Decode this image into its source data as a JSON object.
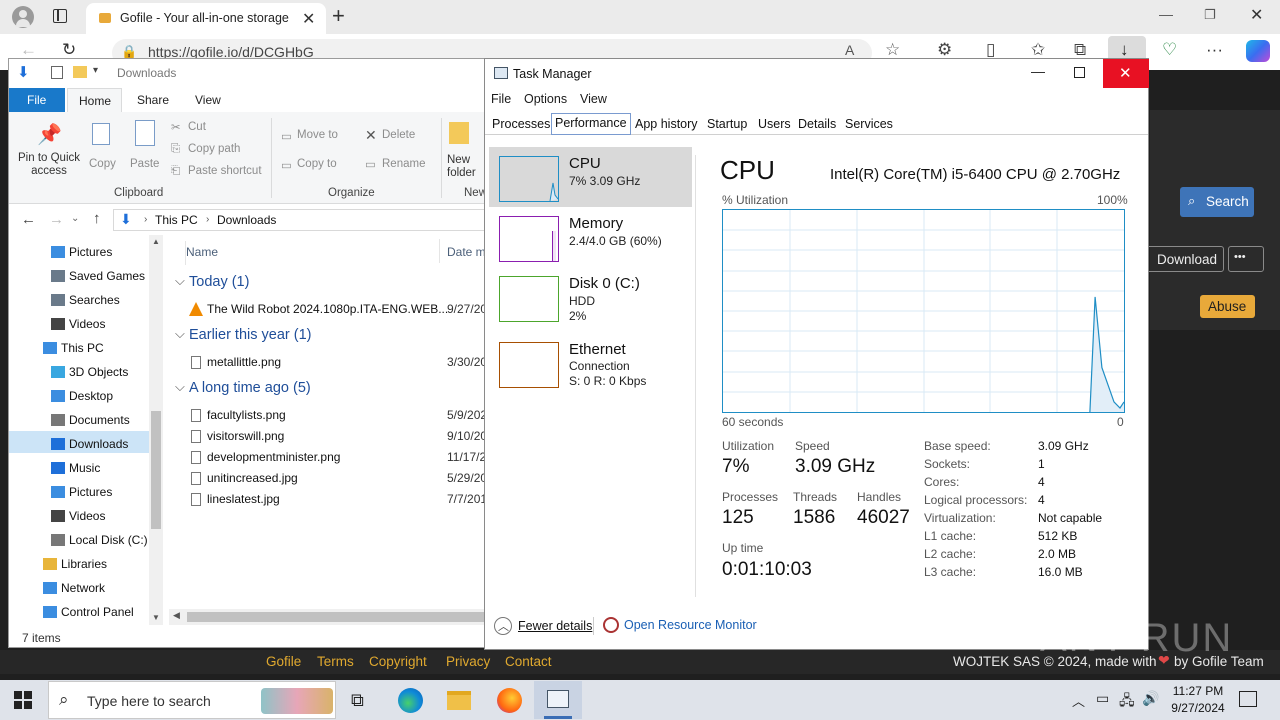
{
  "browser": {
    "tab_title": "Gofile - Your all-in-one storage s",
    "url": "https://gofile.io/d/DCGHbG"
  },
  "gofile": {
    "search_label": "Search",
    "download_label": "Download",
    "more_label": "•••",
    "abuse_label": "Abuse",
    "footer_links": [
      "Gofile",
      "Terms",
      "Copyright",
      "Privacy",
      "Contact"
    ],
    "footer_credit_pre": "WOJTEK SAS © 2024, made with",
    "footer_credit_post": "by Gofile Team",
    "accent_color": "#e0a92f"
  },
  "explorer": {
    "title": "Downloads",
    "ribbon_tabs": [
      "File",
      "Home",
      "Share",
      "View"
    ],
    "clipboard": {
      "pin": "Pin to Quick access",
      "copy": "Copy",
      "paste": "Paste",
      "cut": "Cut",
      "copy_path": "Copy path",
      "paste_shortcut": "Paste shortcut",
      "group": "Clipboard"
    },
    "organize": {
      "move_to": "Move to",
      "copy_to": "Copy to",
      "delete": "Delete",
      "rename": "Rename",
      "group": "Organize"
    },
    "new": {
      "new_folder": "New folder",
      "group": "New"
    },
    "breadcrumb": [
      "This PC",
      "Downloads"
    ],
    "nav": [
      {
        "label": "Pictures",
        "icon": "pictures-icon"
      },
      {
        "label": "Saved Games",
        "icon": "saved-games-icon"
      },
      {
        "label": "Searches",
        "icon": "searches-icon"
      },
      {
        "label": "Videos",
        "icon": "videos-icon"
      },
      {
        "label": "This PC",
        "icon": "this-pc-icon"
      },
      {
        "label": "3D Objects",
        "icon": "3d-objects-icon"
      },
      {
        "label": "Desktop",
        "icon": "desktop-icon"
      },
      {
        "label": "Documents",
        "icon": "documents-icon"
      },
      {
        "label": "Downloads",
        "icon": "downloads-icon"
      },
      {
        "label": "Music",
        "icon": "music-icon"
      },
      {
        "label": "Pictures",
        "icon": "pictures-icon"
      },
      {
        "label": "Videos",
        "icon": "videos-icon"
      },
      {
        "label": "Local Disk (C:)",
        "icon": "local-disk-icon"
      },
      {
        "label": "Libraries",
        "icon": "libraries-icon"
      },
      {
        "label": "Network",
        "icon": "network-icon"
      },
      {
        "label": "Control Panel",
        "icon": "control-panel-icon"
      }
    ],
    "columns": {
      "name": "Name",
      "date": "Date m"
    },
    "groups": [
      {
        "label": "Today (1)",
        "files": [
          {
            "name": "The Wild Robot 2024.1080p.ITA-ENG.WEB...",
            "date": "9/27/20"
          }
        ]
      },
      {
        "label": "Earlier this year (1)",
        "files": [
          {
            "name": "metallittle.png",
            "date": "3/30/20"
          }
        ]
      },
      {
        "label": "A long time ago (5)",
        "files": [
          {
            "name": "facultylists.png",
            "date": "5/9/2024"
          },
          {
            "name": "visitorswill.png",
            "date": "9/10/20"
          },
          {
            "name": "developmentminister.png",
            "date": "11/17/2"
          },
          {
            "name": "unitincreased.jpg",
            "date": "5/29/20"
          },
          {
            "name": "lineslatest.jpg",
            "date": "7/7/201"
          }
        ]
      }
    ],
    "status": "7 items"
  },
  "taskmanager": {
    "title": "Task Manager",
    "menu": [
      "File",
      "Options",
      "View"
    ],
    "tabs": [
      "Processes",
      "Performance",
      "App history",
      "Startup",
      "Users",
      "Details",
      "Services"
    ],
    "active_tab": "Performance",
    "sidebar": [
      {
        "name": "CPU",
        "line1": "7%  3.09 GHz",
        "color": "#1f8ec5"
      },
      {
        "name": "Memory",
        "line1": "2.4/4.0 GB (60%)",
        "color": "#8b1eb0"
      },
      {
        "name": "Disk 0 (C:)",
        "line1": "HDD",
        "line2": "2%",
        "color": "#4ca62c"
      },
      {
        "name": "Ethernet",
        "line1": "Connection",
        "line2": "S: 0 R: 0 Kbps",
        "color": "#a74f01"
      }
    ],
    "cpu": {
      "heading": "CPU",
      "model": "Intel(R) Core(TM) i5-6400 CPU @ 2.70GHz",
      "util_label": "% Utilization",
      "max_label": "100%",
      "time_label": "60 seconds",
      "min_label": "0",
      "utilization_label": "Utilization",
      "utilization": "7%",
      "speed_label": "Speed",
      "speed": "3.09 GHz",
      "processes_label": "Processes",
      "processes": "125",
      "threads_label": "Threads",
      "threads": "1586",
      "handles_label": "Handles",
      "handles": "46027",
      "uptime_label": "Up time",
      "uptime": "0:01:10:03",
      "specs": [
        {
          "k": "Base speed:",
          "v": "3.09 GHz"
        },
        {
          "k": "Sockets:",
          "v": "1"
        },
        {
          "k": "Cores:",
          "v": "4"
        },
        {
          "k": "Logical processors:",
          "v": "4"
        },
        {
          "k": "Virtualization:",
          "v": "Not capable"
        },
        {
          "k": "L1 cache:",
          "v": "512 KB"
        },
        {
          "k": "L2 cache:",
          "v": "2.0 MB"
        },
        {
          "k": "L3 cache:",
          "v": "16.0 MB"
        }
      ],
      "graph_color": "#1f8ec5"
    },
    "fewer_details": "Fewer details",
    "resource_monitor": "Open Resource Monitor"
  },
  "watermark": "ANY RUN",
  "taskbar": {
    "search_placeholder": "Type here to search",
    "time": "11:27 PM",
    "date": "9/27/2024"
  }
}
